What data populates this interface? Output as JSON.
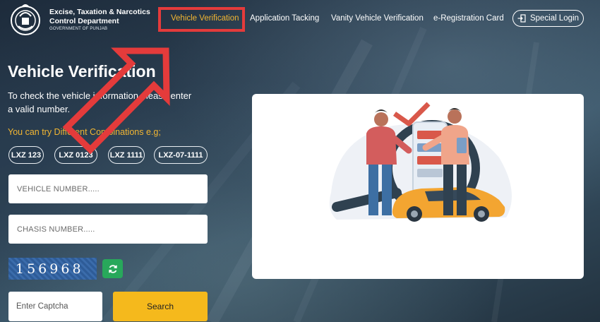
{
  "header": {
    "brand_line1": "Excise, Taxation & Narcotics",
    "brand_line2": "Control Department",
    "brand_line3": "GOVERNMENT OF PUNJAB",
    "logo_icon": "punjab-government-emblem-icon",
    "nav": [
      {
        "label": "Vehicle Verification",
        "active": true
      },
      {
        "label": "Application Tacking",
        "active": false
      },
      {
        "label": "Vanity Vehicle Verification",
        "active": false
      },
      {
        "label": "e-Registration Card",
        "active": false
      }
    ],
    "special_login_label": "Special Login",
    "special_login_icon": "sign-in-icon"
  },
  "main": {
    "title": "Vehicle Verification",
    "intro": "To check the vehicle information please enter a valid number.",
    "combinations_hint": "You can try Different Combinations e.g;",
    "examples": [
      "LXZ 123",
      "LXZ 0123",
      "LXZ 1111",
      "LXZ-07-1111"
    ],
    "vehicle_number_placeholder": "VEHICLE NUMBER.....",
    "chasis_number_placeholder": "CHASIS NUMBER.....",
    "captcha_text": "156968",
    "refresh_icon": "refresh-icon",
    "captcha_placeholder": "Enter Captcha",
    "search_label": "Search"
  },
  "colors": {
    "accent_yellow": "#f2b632",
    "search_button": "#f5b91c",
    "refresh_green": "#28a85b",
    "annotation_red": "#e43b3b"
  }
}
